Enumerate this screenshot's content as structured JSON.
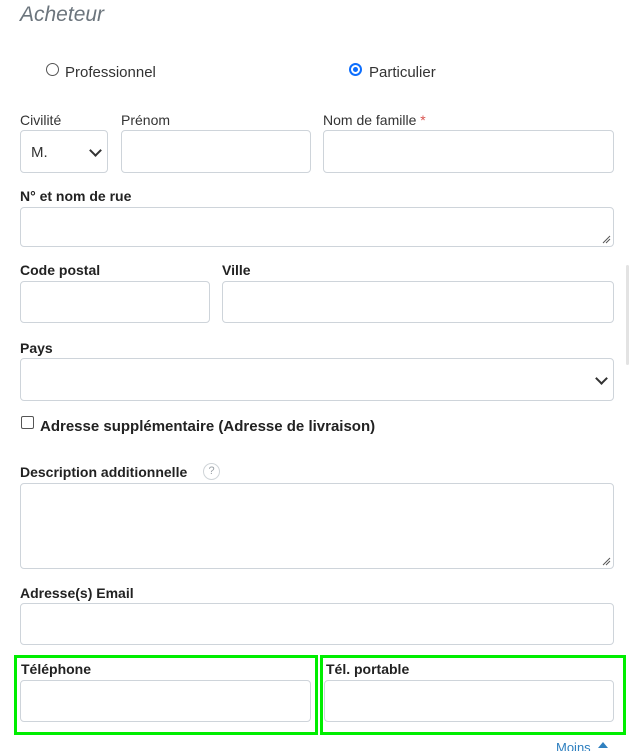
{
  "section_title": "Acheteur",
  "buyer_type": {
    "options": [
      "Professionnel",
      "Particulier"
    ],
    "selected": "Particulier"
  },
  "fields": {
    "civilite_label": "Civilité",
    "civilite_value": "M.",
    "prenom_label": "Prénom",
    "nom_label": "Nom de famille",
    "required_mark": "*",
    "rue_label": "N° et nom de rue",
    "code_postal_label": "Code postal",
    "ville_label": "Ville",
    "pays_label": "Pays",
    "adresse_supp_label": "Adresse supplémentaire (Adresse de livraison)",
    "description_label": "Description additionnelle",
    "help_glyph": "?",
    "email_label": "Adresse(s) Email",
    "telephone_label": "Téléphone",
    "portable_label": "Tél. portable"
  },
  "toggle_link": "Moins",
  "colors": {
    "highlight": "#00ee00",
    "accent": "#0d6efd",
    "required": "#d9534f",
    "link": "#2f80c0"
  },
  "icons": {
    "select_arrow": "chevron-down-icon",
    "textarea_resize": "resize-handle-icon",
    "help": "help-icon",
    "toggle": "caret-up-icon"
  }
}
